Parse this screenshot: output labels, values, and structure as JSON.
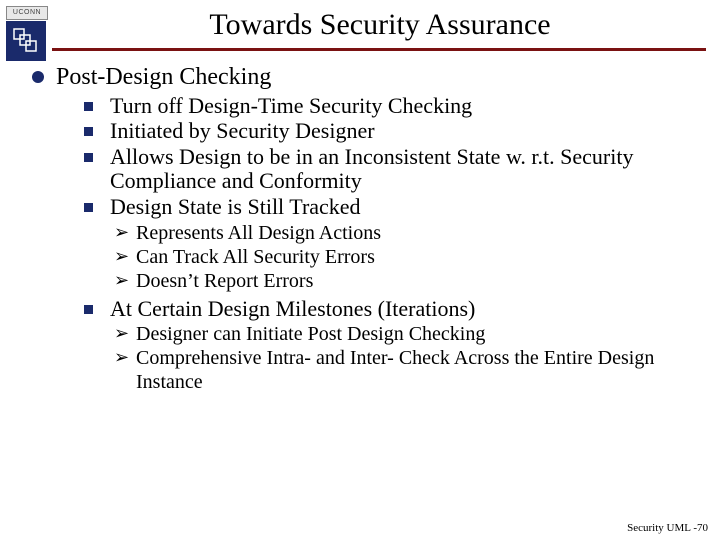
{
  "logo_text": "UCONN",
  "title": "Towards Security Assurance",
  "lvl1": "Post-Design Checking",
  "lvl2a": "Turn off Design-Time Security Checking",
  "lvl2b": "Initiated by Security Designer",
  "lvl2c": "Allows Design to be in an Inconsistent State w. r.t. Security Compliance and Conformity",
  "lvl2d": "Design State is Still Tracked",
  "lvl3a": "Represents All Design Actions",
  "lvl3b": "Can Track All Security Errors",
  "lvl3c": "Doesn’t Report Errors",
  "lvl2e": "At Certain Design Milestones (Iterations)",
  "lvl3d": "Designer can Initiate Post Design Checking",
  "lvl3e": "Comprehensive Intra- and Inter- Check Across the Entire Design Instance",
  "footer": "Security UML -70"
}
